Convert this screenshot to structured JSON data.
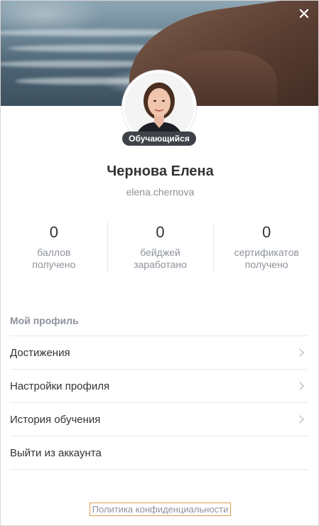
{
  "close_label": "✕",
  "profile": {
    "name": "Чернова Елена",
    "login": "elena.chernova",
    "role": "Обучающийся"
  },
  "stats": [
    {
      "value": "0",
      "label_line1": "баллов",
      "label_line2": "получено"
    },
    {
      "value": "0",
      "label_line1": "бейджей",
      "label_line2": "заработано"
    },
    {
      "value": "0",
      "label_line1": "сертификатов",
      "label_line2": "получено"
    }
  ],
  "menu": {
    "title": "Мой профиль",
    "items": [
      {
        "label": "Достижения",
        "has_chevron": true
      },
      {
        "label": "Настройки профиля",
        "has_chevron": true
      },
      {
        "label": "История обучения",
        "has_chevron": true
      },
      {
        "label": "Выйти из аккаунта",
        "has_chevron": false
      }
    ]
  },
  "footer": {
    "privacy_link": "Политика конфиденциальности"
  },
  "colors": {
    "accent_border": "#e19a4c",
    "badge_bg": "#3f4248",
    "muted_text": "#8d939b"
  }
}
